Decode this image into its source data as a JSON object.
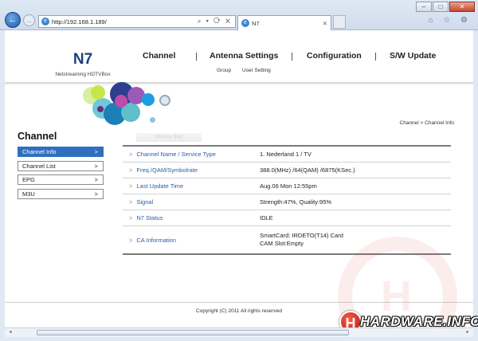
{
  "browser": {
    "url": "http://192.168.1.189/",
    "tab_title": "N7",
    "back_glyph": "←",
    "forward_glyph": "→",
    "ie_glyph": "e",
    "addr_tools": "⌕ ▾ ⟳ ✕",
    "tab_close": "✕",
    "right_tools": "⌂ ☆ ⚙",
    "win_min": "–",
    "win_max": "□",
    "win_close": "✕"
  },
  "brand": {
    "logo": "N7",
    "tagline": "Netstreaming HDTVBox"
  },
  "top_nav": {
    "channel": "Channel",
    "antenna": "Antenna Settings",
    "configuration": "Configuration",
    "sw_update": "S/W Update",
    "separator": "|"
  },
  "sub_nav": {
    "group": "Group",
    "user_setting": "User Setting"
  },
  "breadcrumb": "Channel > Channel Info",
  "sidebar": {
    "title": "Channel",
    "items": [
      {
        "label": "Channel Info",
        "arrow": ">"
      },
      {
        "label": "Channel List",
        "arrow": ">"
      },
      {
        "label": "EPG",
        "arrow": ">"
      },
      {
        "label": "M3U",
        "arrow": ">"
      }
    ]
  },
  "ghost_tab": "Window Step",
  "info_table": {
    "marker": ">",
    "rows": [
      {
        "key": "Channel Name / Service Type",
        "value": "1. Nederland 1 / TV"
      },
      {
        "key": "Freq./QAM/Symbolrate",
        "value": "388.0(MHz) /64(QAM) /6875(KSec.)"
      },
      {
        "key": "Last Update Time",
        "value": "Aug.06 Mon 12:55pm"
      },
      {
        "key": "Signal",
        "value": "Strength:47%, Quality:95%"
      },
      {
        "key": "N7 Status",
        "value": "IDLE"
      },
      {
        "key": "CA Information",
        "value": "SmartCard: IRDETO(T14) Card",
        "value2": "CAM Slot:Empty"
      }
    ]
  },
  "footer": {
    "copyright": "Copyright (C) 2011 All rights reserved"
  },
  "watermark": {
    "h": "H",
    "text": "HARDWARE.INFO"
  },
  "scroll": {
    "left": "◂",
    "right": "▸"
  },
  "colors": {
    "brand_blue": "#1a3f7d",
    "active_item": "#2f6fbf",
    "key_text": "#2a5fa8",
    "watermark_red": "#c8261b"
  }
}
